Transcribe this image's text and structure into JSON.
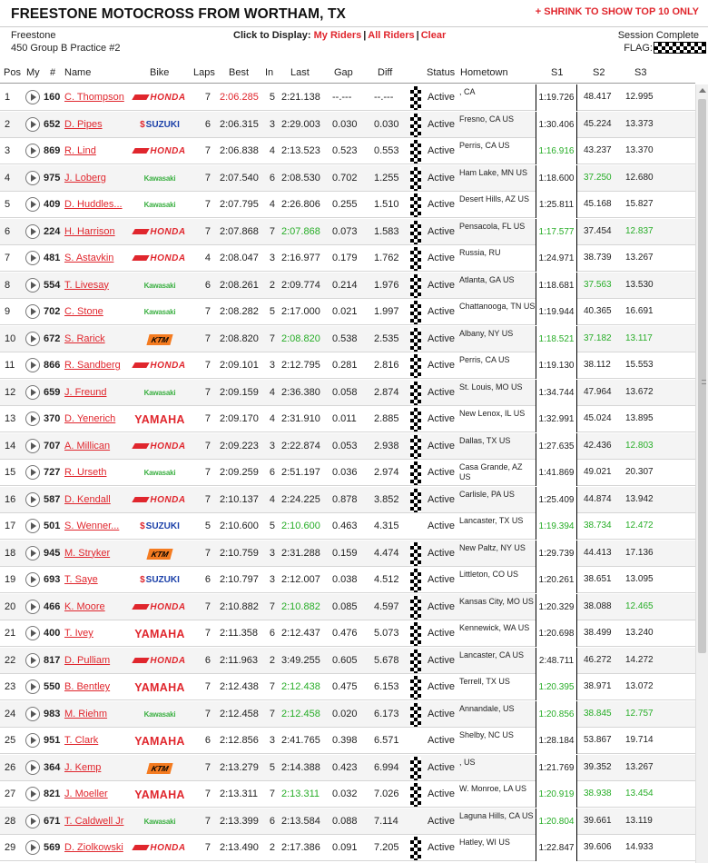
{
  "header": {
    "title": "FREESTONE MOTOCROSS FROM WORTHAM, TX",
    "shrink_link": "+ SHRINK TO SHOW TOP 10 ONLY",
    "track": "Freestone",
    "session": "450 Group B Practice #2",
    "click_to_display": "Click to Display:",
    "my_riders": "My Riders",
    "all_riders": "All Riders",
    "clear": "Clear",
    "separator": "|",
    "session_status": "Session Complete",
    "flag_label": "FLAG:"
  },
  "columns": [
    "Pos",
    "My",
    "#",
    "Name",
    "Bike",
    "Laps",
    "Best",
    "In",
    "Last",
    "Gap",
    "Diff",
    "Status",
    "Hometown",
    "S1",
    "S2",
    "S3"
  ],
  "colors": {
    "accent_red": "#e0262d",
    "best_green": "#27ad27"
  },
  "icons": {
    "play": "play-icon",
    "flag": "checkered-flag-icon"
  },
  "riders": [
    {
      "pos": "1",
      "num": "160",
      "name": "C. Thompson",
      "bike": "honda",
      "bike_label": "HONDA",
      "laps": "7",
      "best": "2:06.285",
      "best_red": true,
      "in": "5",
      "last": "2:21.138",
      "last_green": false,
      "gap": "--.---",
      "diff": "--.---",
      "flag": true,
      "status": "Active",
      "hometown": ", CA",
      "s1": "1:19.726",
      "s1_green": false,
      "s2": "48.417",
      "s2_green": false,
      "s3": "12.995",
      "s3_green": false
    },
    {
      "pos": "2",
      "num": "652",
      "name": "D. Pipes",
      "bike": "suzuki",
      "bike_label": "SUZUKI",
      "laps": "6",
      "best": "2:06.315",
      "best_red": false,
      "in": "3",
      "last": "2:29.003",
      "last_green": false,
      "gap": "0.030",
      "diff": "0.030",
      "flag": true,
      "status": "Active",
      "hometown": "Fresno, CA US",
      "s1": "1:30.406",
      "s1_green": false,
      "s2": "45.224",
      "s2_green": false,
      "s3": "13.373",
      "s3_green": false
    },
    {
      "pos": "3",
      "num": "869",
      "name": "R. Lind",
      "bike": "honda",
      "bike_label": "HONDA",
      "laps": "7",
      "best": "2:06.838",
      "best_red": false,
      "in": "4",
      "last": "2:13.523",
      "last_green": false,
      "gap": "0.523",
      "diff": "0.553",
      "flag": true,
      "status": "Active",
      "hometown": "Perris, CA US",
      "s1": "1:16.916",
      "s1_green": true,
      "s2": "43.237",
      "s2_green": false,
      "s3": "13.370",
      "s3_green": false
    },
    {
      "pos": "4",
      "num": "975",
      "name": "J. Loberg",
      "bike": "kawasaki",
      "bike_label": "Kawasaki",
      "laps": "7",
      "best": "2:07.540",
      "best_red": false,
      "in": "6",
      "last": "2:08.530",
      "last_green": false,
      "gap": "0.702",
      "diff": "1.255",
      "flag": true,
      "status": "Active",
      "hometown": "Ham Lake, MN US",
      "s1": "1:18.600",
      "s1_green": false,
      "s2": "37.250",
      "s2_green": true,
      "s3": "12.680",
      "s3_green": false
    },
    {
      "pos": "5",
      "num": "409",
      "name": "D. Huddles...",
      "bike": "kawasaki",
      "bike_label": "Kawasaki",
      "laps": "7",
      "best": "2:07.795",
      "best_red": false,
      "in": "4",
      "last": "2:26.806",
      "last_green": false,
      "gap": "0.255",
      "diff": "1.510",
      "flag": true,
      "status": "Active",
      "hometown": "Desert Hills, AZ US",
      "s1": "1:25.811",
      "s1_green": false,
      "s2": "45.168",
      "s2_green": false,
      "s3": "15.827",
      "s3_green": false
    },
    {
      "pos": "6",
      "num": "224",
      "name": "H. Harrison",
      "bike": "honda",
      "bike_label": "HONDA",
      "laps": "7",
      "best": "2:07.868",
      "best_red": false,
      "in": "7",
      "last": "2:07.868",
      "last_green": true,
      "gap": "0.073",
      "diff": "1.583",
      "flag": true,
      "status": "Active",
      "hometown": "Pensacola, FL US",
      "s1": "1:17.577",
      "s1_green": true,
      "s2": "37.454",
      "s2_green": false,
      "s3": "12.837",
      "s3_green": true
    },
    {
      "pos": "7",
      "num": "481",
      "name": "S. Astavkin",
      "bike": "honda",
      "bike_label": "HONDA",
      "laps": "4",
      "best": "2:08.047",
      "best_red": false,
      "in": "3",
      "last": "2:16.977",
      "last_green": false,
      "gap": "0.179",
      "diff": "1.762",
      "flag": true,
      "status": "Active",
      "hometown": "Russia, RU",
      "s1": "1:24.971",
      "s1_green": false,
      "s2": "38.739",
      "s2_green": false,
      "s3": "13.267",
      "s3_green": false
    },
    {
      "pos": "8",
      "num": "554",
      "name": "T. Livesay",
      "bike": "kawasaki",
      "bike_label": "Kawasaki",
      "laps": "6",
      "best": "2:08.261",
      "best_red": false,
      "in": "2",
      "last": "2:09.774",
      "last_green": false,
      "gap": "0.214",
      "diff": "1.976",
      "flag": true,
      "status": "Active",
      "hometown": "Atlanta, GA US",
      "s1": "1:18.681",
      "s1_green": false,
      "s2": "37.563",
      "s2_green": true,
      "s3": "13.530",
      "s3_green": false
    },
    {
      "pos": "9",
      "num": "702",
      "name": "C. Stone",
      "bike": "kawasaki",
      "bike_label": "Kawasaki",
      "laps": "7",
      "best": "2:08.282",
      "best_red": false,
      "in": "5",
      "last": "2:17.000",
      "last_green": false,
      "gap": "0.021",
      "diff": "1.997",
      "flag": true,
      "status": "Active",
      "hometown": "Chattanooga, TN US",
      "s1": "1:19.944",
      "s1_green": false,
      "s2": "40.365",
      "s2_green": false,
      "s3": "16.691",
      "s3_green": false
    },
    {
      "pos": "10",
      "num": "672",
      "name": "S. Rarick",
      "bike": "ktm",
      "bike_label": "KTM",
      "laps": "7",
      "best": "2:08.820",
      "best_red": false,
      "in": "7",
      "last": "2:08.820",
      "last_green": true,
      "gap": "0.538",
      "diff": "2.535",
      "flag": true,
      "status": "Active",
      "hometown": "Albany, NY US",
      "s1": "1:18.521",
      "s1_green": true,
      "s2": "37.182",
      "s2_green": true,
      "s3": "13.117",
      "s3_green": true
    },
    {
      "pos": "11",
      "num": "866",
      "name": "R. Sandberg",
      "bike": "honda",
      "bike_label": "HONDA",
      "laps": "7",
      "best": "2:09.101",
      "best_red": false,
      "in": "3",
      "last": "2:12.795",
      "last_green": false,
      "gap": "0.281",
      "diff": "2.816",
      "flag": true,
      "status": "Active",
      "hometown": "Perris, CA US",
      "s1": "1:19.130",
      "s1_green": false,
      "s2": "38.112",
      "s2_green": false,
      "s3": "15.553",
      "s3_green": false
    },
    {
      "pos": "12",
      "num": "659",
      "name": "J. Freund",
      "bike": "kawasaki",
      "bike_label": "Kawasaki",
      "laps": "7",
      "best": "2:09.159",
      "best_red": false,
      "in": "4",
      "last": "2:36.380",
      "last_green": false,
      "gap": "0.058",
      "diff": "2.874",
      "flag": true,
      "status": "Active",
      "hometown": "St. Louis, MO US",
      "s1": "1:34.744",
      "s1_green": false,
      "s2": "47.964",
      "s2_green": false,
      "s3": "13.672",
      "s3_green": false
    },
    {
      "pos": "13",
      "num": "370",
      "name": "D. Yenerich",
      "bike": "yamaha",
      "bike_label": "YAMAHA",
      "laps": "7",
      "best": "2:09.170",
      "best_red": false,
      "in": "4",
      "last": "2:31.910",
      "last_green": false,
      "gap": "0.011",
      "diff": "2.885",
      "flag": true,
      "status": "Active",
      "hometown": "New Lenox, IL US",
      "s1": "1:32.991",
      "s1_green": false,
      "s2": "45.024",
      "s2_green": false,
      "s3": "13.895",
      "s3_green": false
    },
    {
      "pos": "14",
      "num": "707",
      "name": "A. Millican",
      "bike": "honda",
      "bike_label": "HONDA",
      "laps": "7",
      "best": "2:09.223",
      "best_red": false,
      "in": "3",
      "last": "2:22.874",
      "last_green": false,
      "gap": "0.053",
      "diff": "2.938",
      "flag": true,
      "status": "Active",
      "hometown": "Dallas, TX US",
      "s1": "1:27.635",
      "s1_green": false,
      "s2": "42.436",
      "s2_green": false,
      "s3": "12.803",
      "s3_green": true
    },
    {
      "pos": "15",
      "num": "727",
      "name": "R. Urseth",
      "bike": "kawasaki",
      "bike_label": "Kawasaki",
      "laps": "7",
      "best": "2:09.259",
      "best_red": false,
      "in": "6",
      "last": "2:51.197",
      "last_green": false,
      "gap": "0.036",
      "diff": "2.974",
      "flag": true,
      "status": "Active",
      "hometown": "Casa Grande, AZ US",
      "s1": "1:41.869",
      "s1_green": false,
      "s2": "49.021",
      "s2_green": false,
      "s3": "20.307",
      "s3_green": false
    },
    {
      "pos": "16",
      "num": "587",
      "name": "D. Kendall",
      "bike": "honda",
      "bike_label": "HONDA",
      "laps": "7",
      "best": "2:10.137",
      "best_red": false,
      "in": "4",
      "last": "2:24.225",
      "last_green": false,
      "gap": "0.878",
      "diff": "3.852",
      "flag": true,
      "status": "Active",
      "hometown": "Carlisle, PA US",
      "s1": "1:25.409",
      "s1_green": false,
      "s2": "44.874",
      "s2_green": false,
      "s3": "13.942",
      "s3_green": false
    },
    {
      "pos": "17",
      "num": "501",
      "name": "S. Wenner...",
      "bike": "suzuki",
      "bike_label": "SUZUKI",
      "laps": "5",
      "best": "2:10.600",
      "best_red": false,
      "in": "5",
      "last": "2:10.600",
      "last_green": true,
      "gap": "0.463",
      "diff": "4.315",
      "flag": false,
      "status": "Active",
      "hometown": "Lancaster, TX US",
      "s1": "1:19.394",
      "s1_green": true,
      "s2": "38.734",
      "s2_green": true,
      "s3": "12.472",
      "s3_green": true
    },
    {
      "pos": "18",
      "num": "945",
      "name": "M. Stryker",
      "bike": "ktm",
      "bike_label": "KTM",
      "laps": "7",
      "best": "2:10.759",
      "best_red": false,
      "in": "3",
      "last": "2:31.288",
      "last_green": false,
      "gap": "0.159",
      "diff": "4.474",
      "flag": true,
      "status": "Active",
      "hometown": "New Paltz, NY US",
      "s1": "1:29.739",
      "s1_green": false,
      "s2": "44.413",
      "s2_green": false,
      "s3": "17.136",
      "s3_green": false
    },
    {
      "pos": "19",
      "num": "693",
      "name": "T. Saye",
      "bike": "suzuki",
      "bike_label": "SUZUKI",
      "laps": "6",
      "best": "2:10.797",
      "best_red": false,
      "in": "3",
      "last": "2:12.007",
      "last_green": false,
      "gap": "0.038",
      "diff": "4.512",
      "flag": true,
      "status": "Active",
      "hometown": "Littleton, CO US",
      "s1": "1:20.261",
      "s1_green": false,
      "s2": "38.651",
      "s2_green": false,
      "s3": "13.095",
      "s3_green": false
    },
    {
      "pos": "20",
      "num": "466",
      "name": "K. Moore",
      "bike": "honda",
      "bike_label": "HONDA",
      "laps": "7",
      "best": "2:10.882",
      "best_red": false,
      "in": "7",
      "last": "2:10.882",
      "last_green": true,
      "gap": "0.085",
      "diff": "4.597",
      "flag": true,
      "status": "Active",
      "hometown": "Kansas City, MO US",
      "s1": "1:20.329",
      "s1_green": false,
      "s2": "38.088",
      "s2_green": false,
      "s3": "12.465",
      "s3_green": true
    },
    {
      "pos": "21",
      "num": "400",
      "name": "T. Ivey",
      "bike": "yamaha",
      "bike_label": "YAMAHA",
      "laps": "7",
      "best": "2:11.358",
      "best_red": false,
      "in": "6",
      "last": "2:12.437",
      "last_green": false,
      "gap": "0.476",
      "diff": "5.073",
      "flag": true,
      "status": "Active",
      "hometown": "Kennewick, WA US",
      "s1": "1:20.698",
      "s1_green": false,
      "s2": "38.499",
      "s2_green": false,
      "s3": "13.240",
      "s3_green": false
    },
    {
      "pos": "22",
      "num": "817",
      "name": "D. Pulliam",
      "bike": "honda",
      "bike_label": "HONDA",
      "laps": "6",
      "best": "2:11.963",
      "best_red": false,
      "in": "2",
      "last": "3:49.255",
      "last_green": false,
      "gap": "0.605",
      "diff": "5.678",
      "flag": true,
      "status": "Active",
      "hometown": "Lancaster, CA US",
      "s1": "2:48.711",
      "s1_green": false,
      "s2": "46.272",
      "s2_green": false,
      "s3": "14.272",
      "s3_green": false
    },
    {
      "pos": "23",
      "num": "550",
      "name": "B. Bentley",
      "bike": "yamaha",
      "bike_label": "YAMAHA",
      "laps": "7",
      "best": "2:12.438",
      "best_red": false,
      "in": "7",
      "last": "2:12.438",
      "last_green": true,
      "gap": "0.475",
      "diff": "6.153",
      "flag": true,
      "status": "Active",
      "hometown": "Terrell, TX US",
      "s1": "1:20.395",
      "s1_green": true,
      "s2": "38.971",
      "s2_green": false,
      "s3": "13.072",
      "s3_green": false
    },
    {
      "pos": "24",
      "num": "983",
      "name": "M. Riehm",
      "bike": "kawasaki",
      "bike_label": "Kawasaki",
      "laps": "7",
      "best": "2:12.458",
      "best_red": false,
      "in": "7",
      "last": "2:12.458",
      "last_green": true,
      "gap": "0.020",
      "diff": "6.173",
      "flag": true,
      "status": "Active",
      "hometown": "Annandale, US",
      "s1": "1:20.856",
      "s1_green": true,
      "s2": "38.845",
      "s2_green": true,
      "s3": "12.757",
      "s3_green": true
    },
    {
      "pos": "25",
      "num": "951",
      "name": "T. Clark",
      "bike": "yamaha",
      "bike_label": "YAMAHA",
      "laps": "6",
      "best": "2:12.856",
      "best_red": false,
      "in": "3",
      "last": "2:41.765",
      "last_green": false,
      "gap": "0.398",
      "diff": "6.571",
      "flag": false,
      "status": "Active",
      "hometown": "Shelby, NC US",
      "s1": "1:28.184",
      "s1_green": false,
      "s2": "53.867",
      "s2_green": false,
      "s3": "19.714",
      "s3_green": false
    },
    {
      "pos": "26",
      "num": "364",
      "name": "J. Kemp",
      "bike": "ktm",
      "bike_label": "KTM",
      "laps": "7",
      "best": "2:13.279",
      "best_red": false,
      "in": "5",
      "last": "2:14.388",
      "last_green": false,
      "gap": "0.423",
      "diff": "6.994",
      "flag": true,
      "status": "Active",
      "hometown": ", US",
      "s1": "1:21.769",
      "s1_green": false,
      "s2": "39.352",
      "s2_green": false,
      "s3": "13.267",
      "s3_green": false
    },
    {
      "pos": "27",
      "num": "821",
      "name": "J. Moeller",
      "bike": "yamaha",
      "bike_label": "YAMAHA",
      "laps": "7",
      "best": "2:13.311",
      "best_red": false,
      "in": "7",
      "last": "2:13.311",
      "last_green": true,
      "gap": "0.032",
      "diff": "7.026",
      "flag": true,
      "status": "Active",
      "hometown": "W. Monroe, LA US",
      "s1": "1:20.919",
      "s1_green": true,
      "s2": "38.938",
      "s2_green": true,
      "s3": "13.454",
      "s3_green": true
    },
    {
      "pos": "28",
      "num": "671",
      "name": "T. Caldwell Jr",
      "bike": "kawasaki",
      "bike_label": "Kawasaki",
      "laps": "7",
      "best": "2:13.399",
      "best_red": false,
      "in": "6",
      "last": "2:13.584",
      "last_green": false,
      "gap": "0.088",
      "diff": "7.114",
      "flag": false,
      "status": "Active",
      "hometown": "Laguna Hills, CA US",
      "s1": "1:20.804",
      "s1_green": true,
      "s2": "39.661",
      "s3": "13.119",
      "s2_green": false,
      "s3_green": false
    },
    {
      "pos": "29",
      "num": "569",
      "name": "D. Ziolkowski",
      "bike": "honda",
      "bike_label": "HONDA",
      "laps": "7",
      "best": "2:13.490",
      "best_red": false,
      "in": "2",
      "last": "2:17.386",
      "last_green": false,
      "gap": "0.091",
      "diff": "7.205",
      "flag": true,
      "status": "Active",
      "hometown": "Hatley, WI US",
      "s1": "1:22.847",
      "s1_green": false,
      "s2": "39.606",
      "s2_green": false,
      "s3": "14.933",
      "s3_green": false
    }
  ]
}
